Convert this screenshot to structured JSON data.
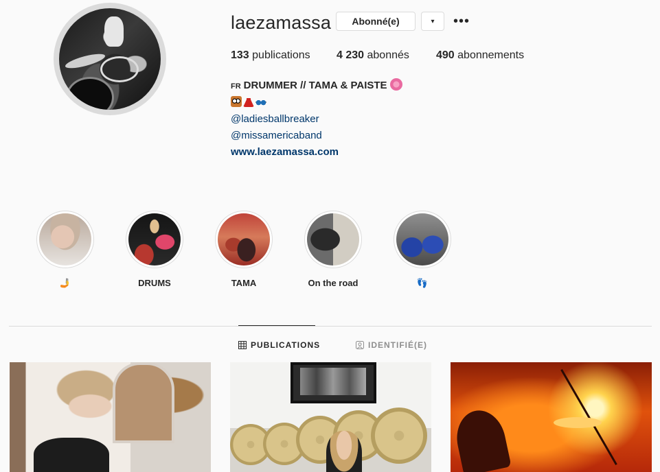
{
  "profile": {
    "username": "laezamassa",
    "follow_button": "Abonné(e)",
    "dropdown_icon": "▾",
    "more_icon": "•••",
    "stats": {
      "posts_count": "133",
      "posts_label": "publications",
      "followers_count": "4 230",
      "followers_label": "abonnés",
      "following_count": "490",
      "following_label": "abonnements"
    },
    "bio": {
      "flag": "FR",
      "headline": "DRUMMER // TAMA & PAISTE",
      "emoji_line": [
        "owl",
        "dress",
        "sunglasses"
      ],
      "mention1": "@ladiesballbreaker",
      "mention2": "@missamericaband",
      "website": "www.laezamassa.com"
    }
  },
  "highlights": [
    {
      "label": "🤳",
      "icon": "selfie-emoji"
    },
    {
      "label": "DRUMS",
      "icon": ""
    },
    {
      "label": "TAMA",
      "icon": ""
    },
    {
      "label": "On the road",
      "icon": ""
    },
    {
      "label": "👣",
      "icon": "footprints-emoji"
    }
  ],
  "tabs": {
    "publications": "PUBLICATIONS",
    "tagged": "IDENTIFIÉ(E)"
  },
  "colors": {
    "text": "#262626",
    "link": "#00376b",
    "border": "#dbdbdb",
    "muted": "#8e8e8e",
    "background": "#fafafa"
  }
}
